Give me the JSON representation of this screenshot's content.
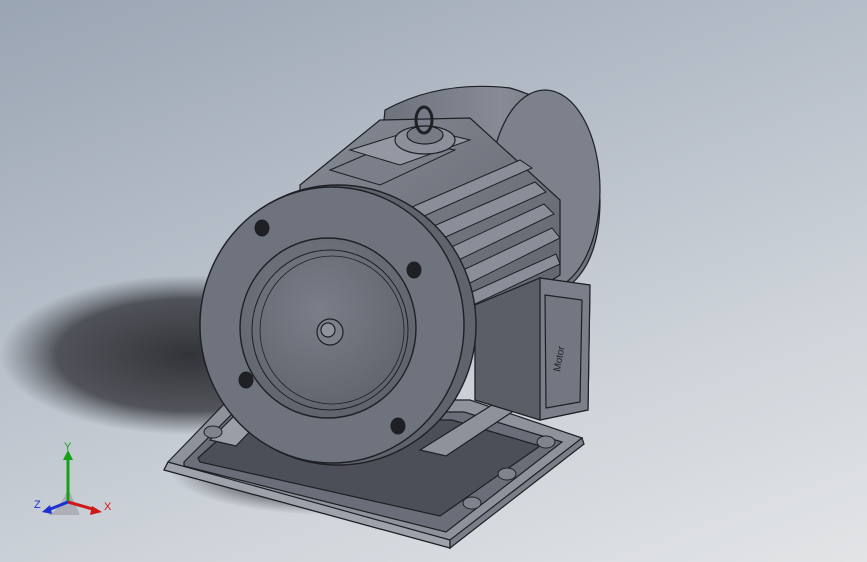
{
  "model": {
    "nameplate_text": "Motor",
    "colors": {
      "body": "#70747e",
      "body_light": "#8a8e98",
      "body_dark": "#4a4d55",
      "flange": "#6b6f79",
      "edge": "#1e2024",
      "shadow": "#2a2c30"
    }
  },
  "triad": {
    "x_label": "X",
    "y_label": "Y",
    "z_label": "Z",
    "colors": {
      "x": "#d01818",
      "y": "#17a117",
      "z": "#1c2fd0"
    }
  }
}
